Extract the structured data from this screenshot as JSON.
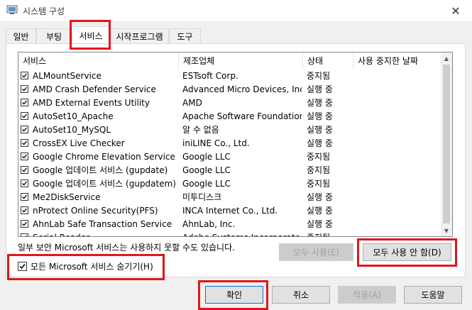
{
  "window": {
    "title": "시스템 구성"
  },
  "tabs": [
    {
      "label": "일반"
    },
    {
      "label": "부팅"
    },
    {
      "label": "서비스"
    },
    {
      "label": "시작프로그램"
    },
    {
      "label": "도구"
    }
  ],
  "columns": [
    "서비스",
    "제조업체",
    "상태",
    "사용 중지한 날짜"
  ],
  "services": [
    {
      "name": "ALMountService",
      "vendor": "ESTsoft Corp.",
      "status": "중지됨"
    },
    {
      "name": "AMD Crash Defender Service",
      "vendor": "Advanced Micro Devices, Inc.",
      "status": "실행 중"
    },
    {
      "name": "AMD External Events Utility",
      "vendor": "AMD",
      "status": "실행 중"
    },
    {
      "name": "AutoSet10_Apache",
      "vendor": "Apache Software Foundation",
      "status": "실행 중"
    },
    {
      "name": "AutoSet10_MySQL",
      "vendor": "알 수 없음",
      "status": "실행 중"
    },
    {
      "name": "CrossEX Live Checker",
      "vendor": "iniLINE Co., Ltd.",
      "status": "실행 중"
    },
    {
      "name": "Google Chrome Elevation Service (...",
      "vendor": "Google LLC",
      "status": "중지됨"
    },
    {
      "name": "Google 업데이트 서비스 (gupdate)",
      "vendor": "Google LLC",
      "status": "중지됨"
    },
    {
      "name": "Google 업데이트 서비스 (gupdatem)",
      "vendor": "Google LLC",
      "status": "중지됨"
    },
    {
      "name": "Me2DiskService",
      "vendor": "미투디스크",
      "status": "실행 중"
    },
    {
      "name": "nProtect Online Security(PFS)",
      "vendor": "INCA Internet Co., Ltd.",
      "status": "실행 중"
    },
    {
      "name": "AhnLab Safe Transaction Service",
      "vendor": "AhnLab, Inc.",
      "status": "실행 중"
    },
    {
      "name": "Serial Reader",
      "vendor": "Adobe Systems Incorporated",
      "status": "중지됨"
    }
  ],
  "note": "일부 보안 Microsoft 서비스는 사용하지 못할 수도 있습니다.",
  "buttons": {
    "enable_all": "모두 사용(E)",
    "disable_all": "모두 사용 안 함(D)",
    "ok": "확인",
    "cancel": "취소",
    "apply": "적용(A)",
    "help": "도움말"
  },
  "hide_ms": {
    "label": "모든 Microsoft 서비스 숨기기(H)",
    "checked": true
  },
  "colors": {
    "highlight_box": "#e0161e",
    "accent": "#0078d7"
  }
}
